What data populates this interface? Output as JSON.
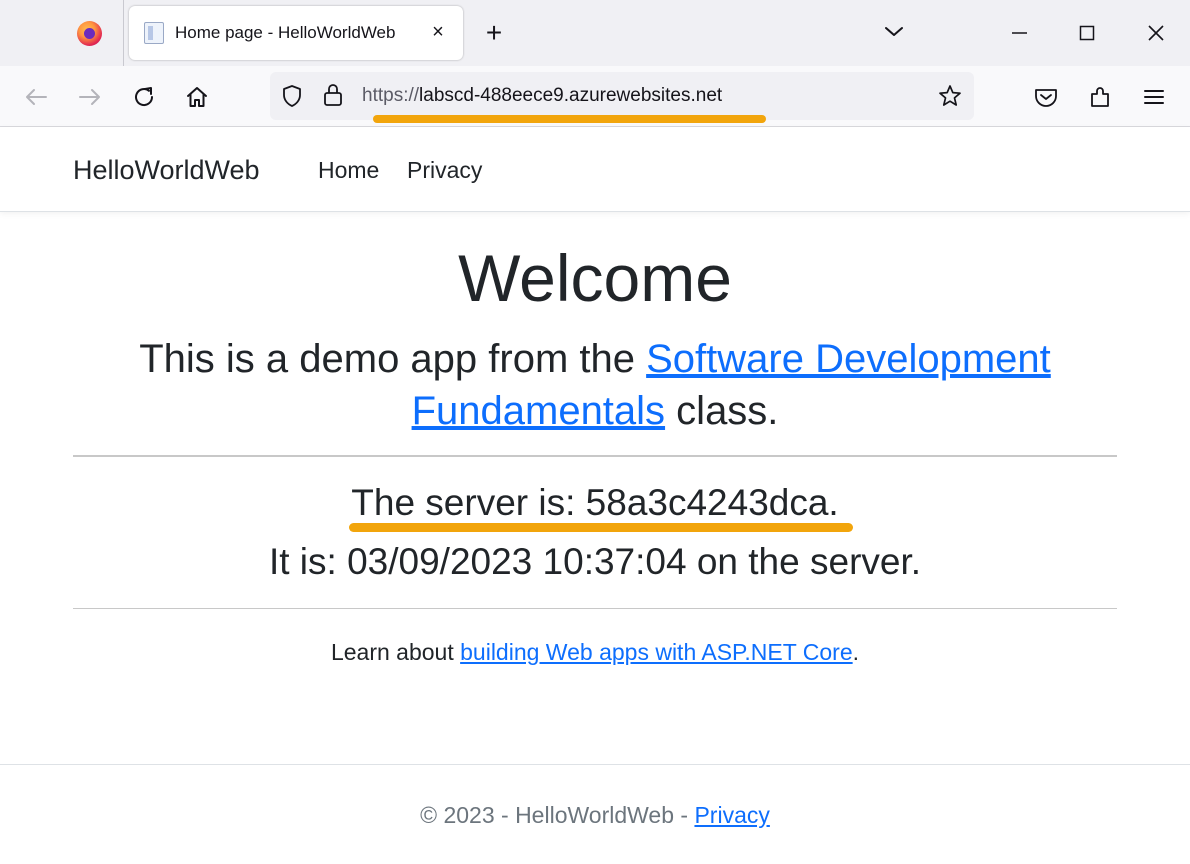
{
  "browser": {
    "tab_title": "Home page - HelloWorldWeb",
    "tab_close": "×",
    "new_tab": "+",
    "url_scheme": "https://",
    "url_host": "labscd-488eece9.azurewebsites.net",
    "highlight_color": "#f2a50c"
  },
  "nav": {
    "brand": "HelloWorldWeb",
    "links": [
      "Home",
      "Privacy"
    ]
  },
  "main": {
    "heading": "Welcome",
    "intro_before": "This is a demo app from the ",
    "intro_link": "Software Development Fundamentals",
    "intro_after": " class.",
    "server_line": "The server is: 58a3c4243dca.",
    "time_line": "It is: 03/09/2023 10:37:04 on the server.",
    "learn_before": "Learn about ",
    "learn_link": "building Web apps with ASP.NET Core",
    "learn_after": "."
  },
  "footer": {
    "text": "© 2023 - HelloWorldWeb - ",
    "link": "Privacy"
  },
  "colors": {
    "link": "#0d6efd",
    "accent_underline": "#f2a50c"
  }
}
